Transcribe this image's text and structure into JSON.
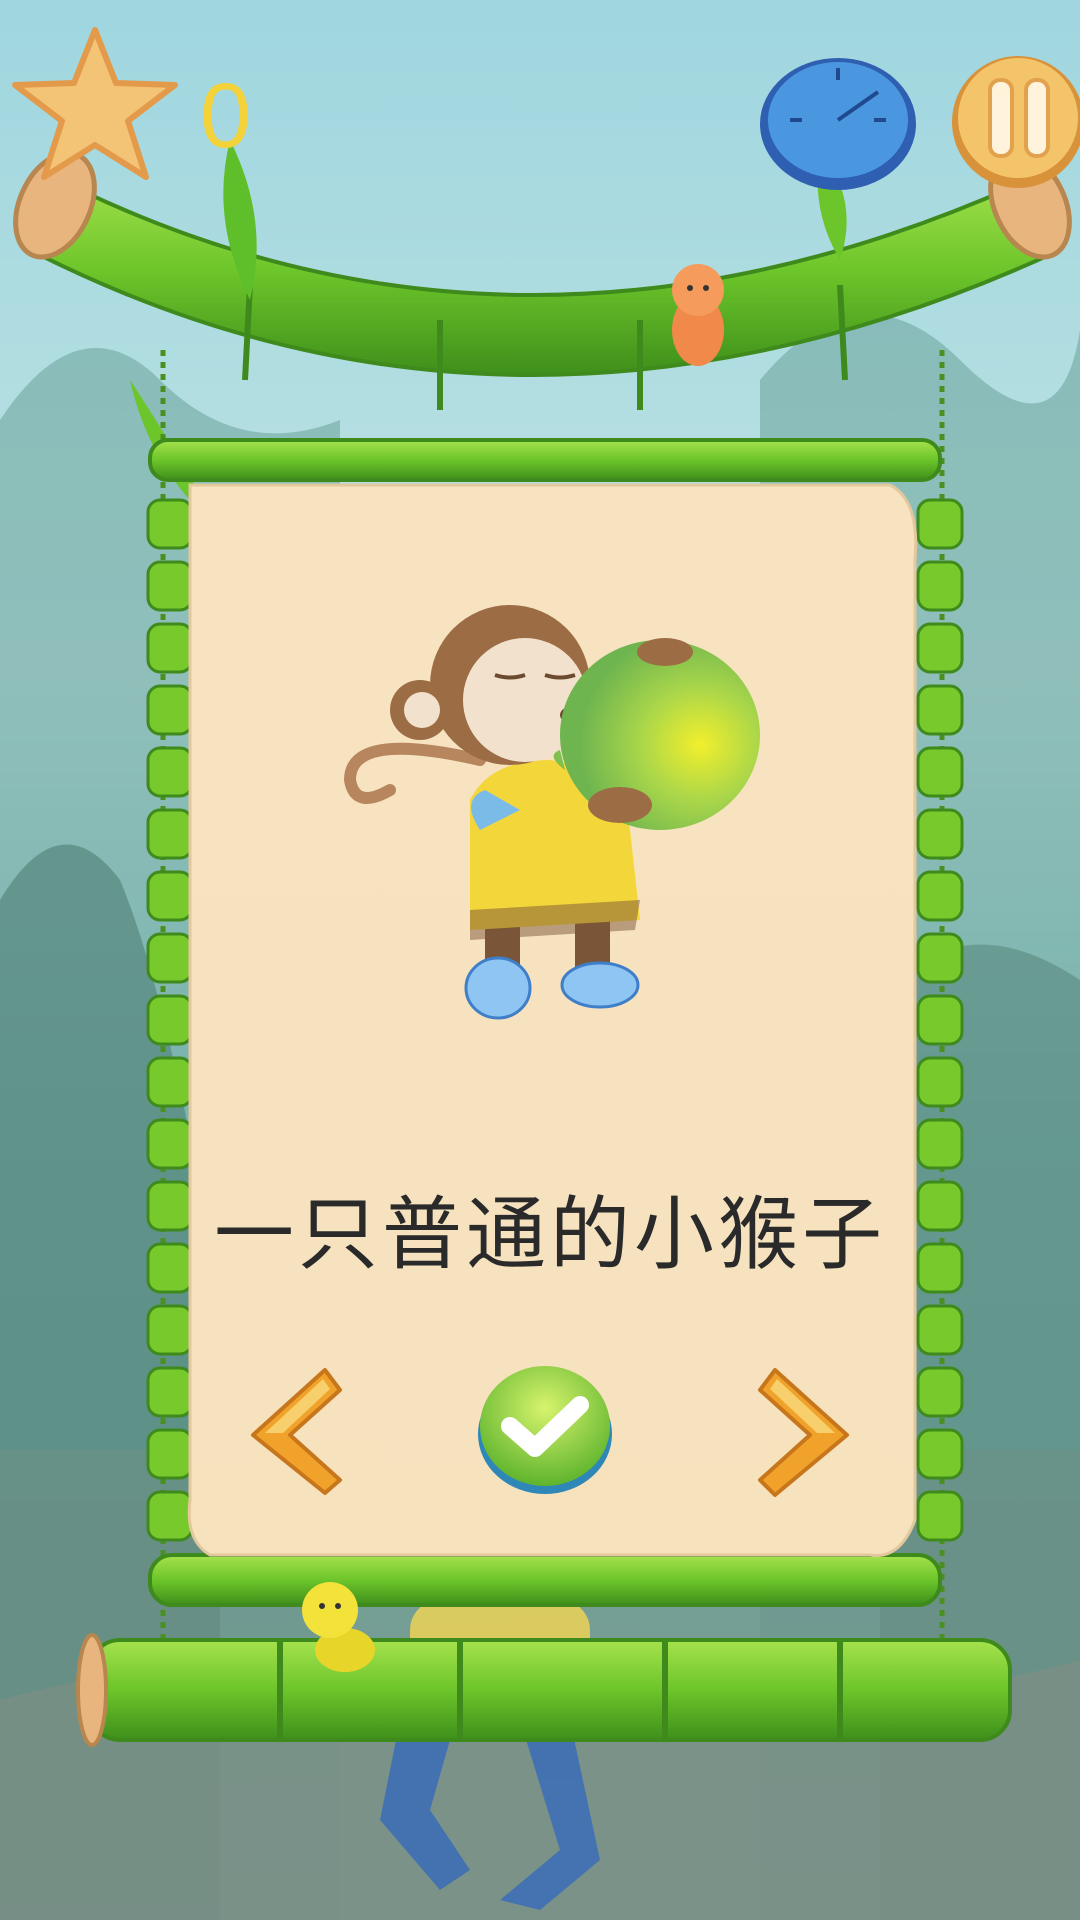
{
  "hud": {
    "score": "0",
    "icons": {
      "star": "star-icon",
      "timer": "timer-icon",
      "pause": "pause-icon"
    }
  },
  "card": {
    "caption": "一只普通的小猴子",
    "character": "monkey-with-balloon"
  },
  "controls": {
    "prev": "chevron-left-icon",
    "confirm": "checkmark-icon",
    "next": "chevron-right-icon"
  },
  "colors": {
    "bamboo": "#7dcb2e",
    "parchment": "#f8e6c2",
    "score": "#f3d23a",
    "confirm": "#8fd33a",
    "arrow": "#f0a22a"
  }
}
